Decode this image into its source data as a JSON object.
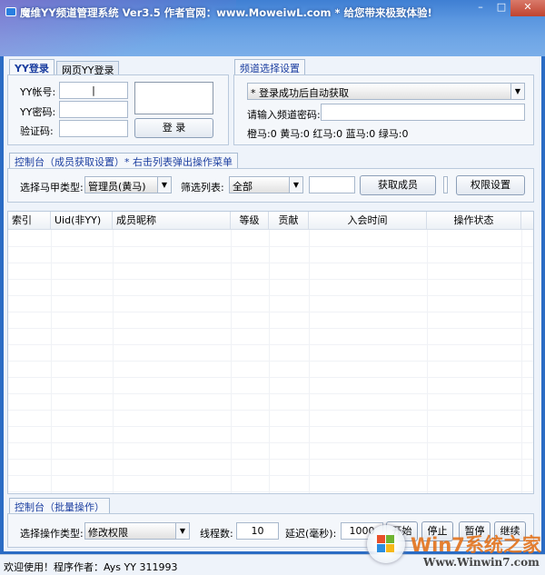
{
  "window": {
    "title": "魔维YY频道管理系统 Ver3.5   作者官网：www.MoweiwL.com   *   给您带来极致体验!",
    "minimize": "–",
    "maximize": "□",
    "close": "✕"
  },
  "login": {
    "tabs": [
      "YY登录",
      "网页YY登录"
    ],
    "account_label": "YY帐号:",
    "account_value": "|",
    "password_label": "YY密码:",
    "captcha_label": "验证码:",
    "login_button": "登 录"
  },
  "channel": {
    "tab": "频道选择设置",
    "channel_select": "* 登录成功后自动获取",
    "password_label": "请输入频道密码:",
    "counts": "橙马:0  黄马:0  红马:0  蓝马:0  绿马:0"
  },
  "control": {
    "tab": "控制台（成员获取设置）* 右击列表弹出操作菜单",
    "vest_label": "选择马甲类型:",
    "vest_value": "管理员(黄马)",
    "filter_label": "筛选列表:",
    "filter_value": "全部",
    "get_members": "获取成员",
    "permissions": "权限设置"
  },
  "table": {
    "columns": [
      "索引",
      "Uid(非YY)",
      "成员昵称",
      "等级",
      "贡献",
      "入会时间",
      "操作状态"
    ]
  },
  "batch": {
    "tab": "控制台（批量操作）",
    "op_label": "选择操作类型:",
    "op_value": "修改权限",
    "threads_label": "线程数:",
    "threads_value": "10",
    "delay_label": "延迟(毫秒):",
    "delay_value": "1000",
    "start": "开始",
    "stop": "停止",
    "pause": "暂停",
    "resume": "继续"
  },
  "status": {
    "text": "欢迎使用！程序作者：Ays YY 311993"
  },
  "watermark": {
    "brand": "Win7系统之家",
    "url": "Www.Winwin7.com"
  }
}
